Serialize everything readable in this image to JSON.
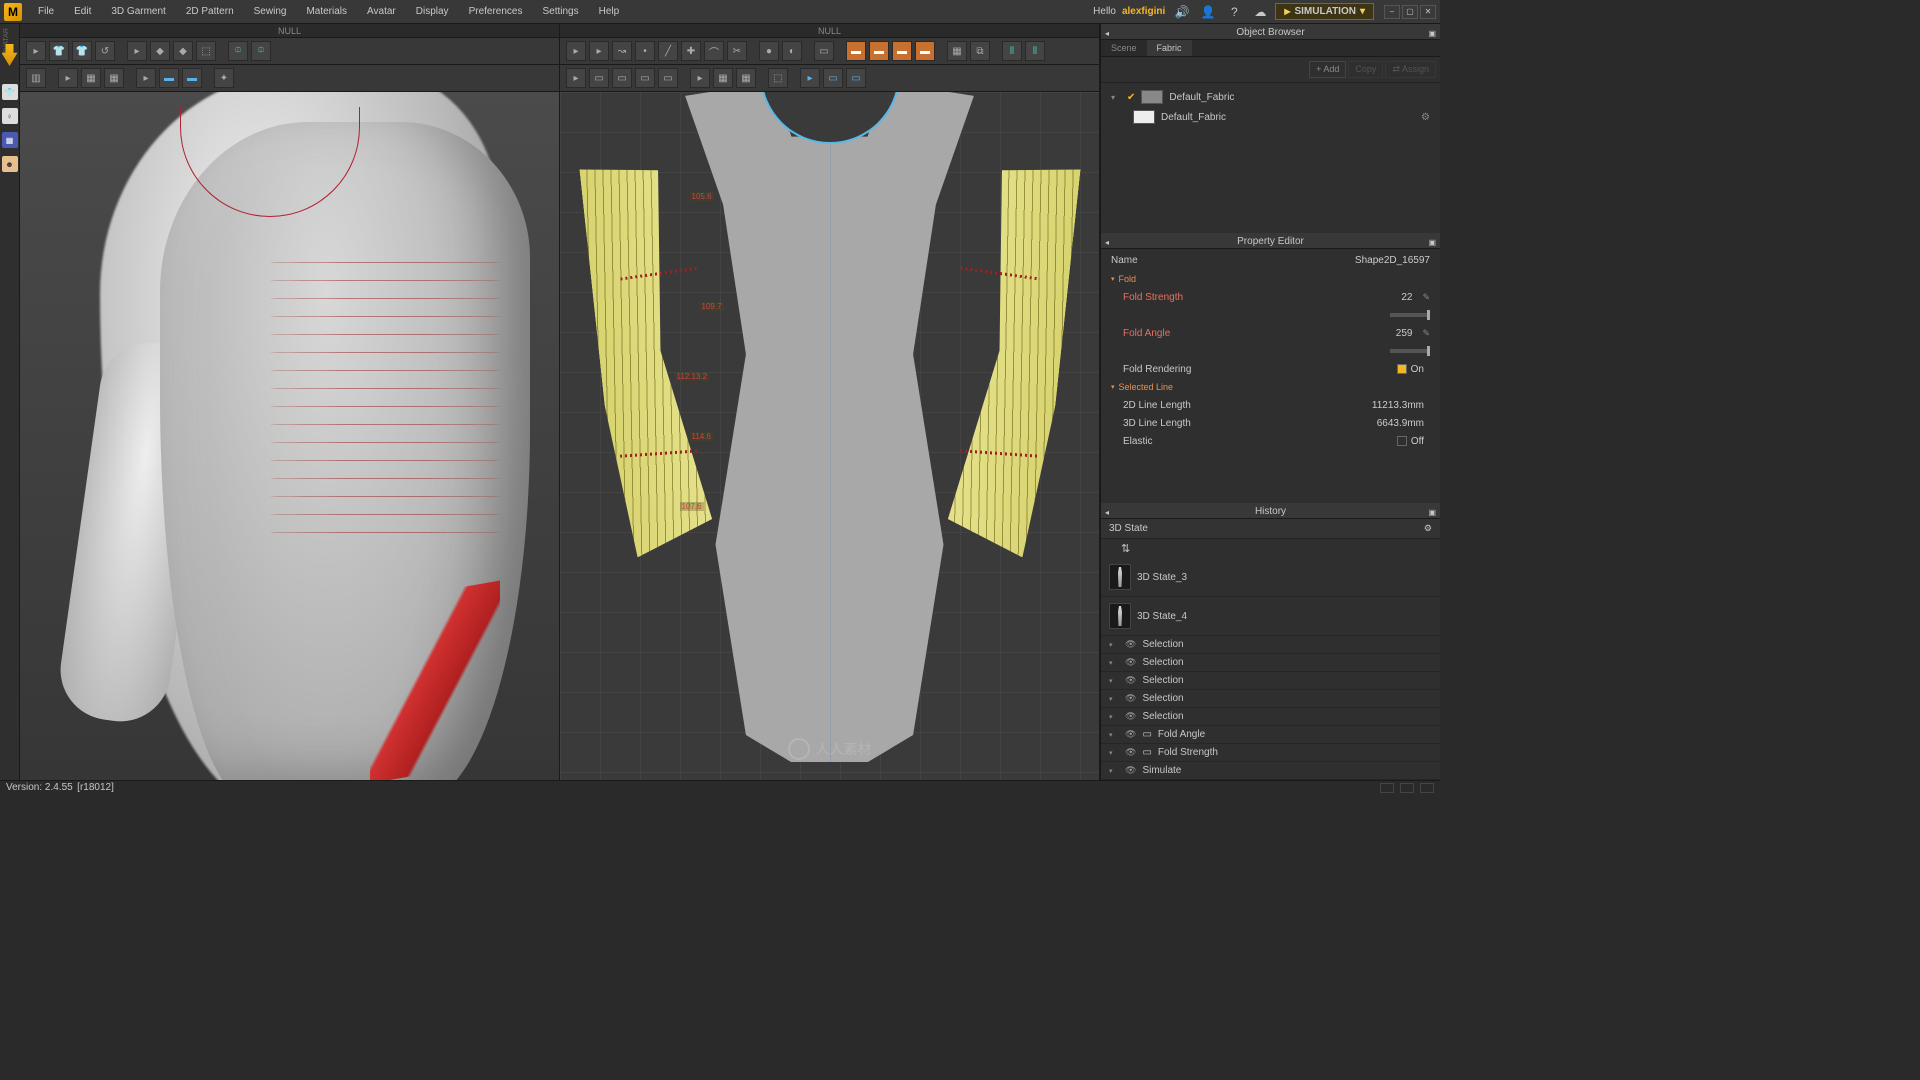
{
  "menu": [
    "File",
    "Edit",
    "3D Garment",
    "2D Pattern",
    "Sewing",
    "Materials",
    "Avatar",
    "Display",
    "Preferences",
    "Settings",
    "Help"
  ],
  "top_right": {
    "hello": "Hello",
    "user": "alexfigini",
    "sim": "SIMULATION"
  },
  "viewports": {
    "title3d": "NULL",
    "title2d": "NULL"
  },
  "object_browser": {
    "title": "Object Browser",
    "tabs": [
      "Scene",
      "Fabric"
    ],
    "actions": {
      "add": "+ Add",
      "copy": "Copy",
      "assign": "⇄ Assign"
    },
    "fabrics": [
      {
        "name": "Default_Fabric",
        "swatch": "grey",
        "checked": true
      },
      {
        "name": "Default_Fabric",
        "swatch": "white",
        "checked": false
      }
    ]
  },
  "property_editor": {
    "title": "Property Editor",
    "name_label": "Name",
    "name_value": "Shape2D_16597",
    "sections": {
      "fold": {
        "title": "Fold",
        "strength_label": "Fold Strength",
        "strength_value": "22",
        "angle_label": "Fold Angle",
        "angle_value": "259",
        "rendering_label": "Fold Rendering",
        "rendering_value": "On"
      },
      "selected": {
        "title": "Selected Line",
        "len2d_label": "2D Line Length",
        "len2d_value": "11213.3mm",
        "len3d_label": "3D Line Length",
        "len3d_value": "6643.9mm",
        "elastic_label": "Elastic",
        "elastic_value": "Off"
      }
    }
  },
  "history": {
    "title": "History",
    "state_header": "3D State",
    "states": [
      "3D State_3",
      "3D State_4"
    ],
    "items": [
      "Selection",
      "Selection",
      "Selection",
      "Selection",
      "Selection",
      "Fold Angle",
      "Fold Strength",
      "Simulate"
    ]
  },
  "measurements": {
    "m1": "105.6",
    "m2": "109.7",
    "m3": "112.13.2",
    "m4": "114.6",
    "m5": "107.6"
  },
  "status": {
    "version": "Version: 2.4.55",
    "build": "[r18012]"
  },
  "watermark": "人人素材"
}
